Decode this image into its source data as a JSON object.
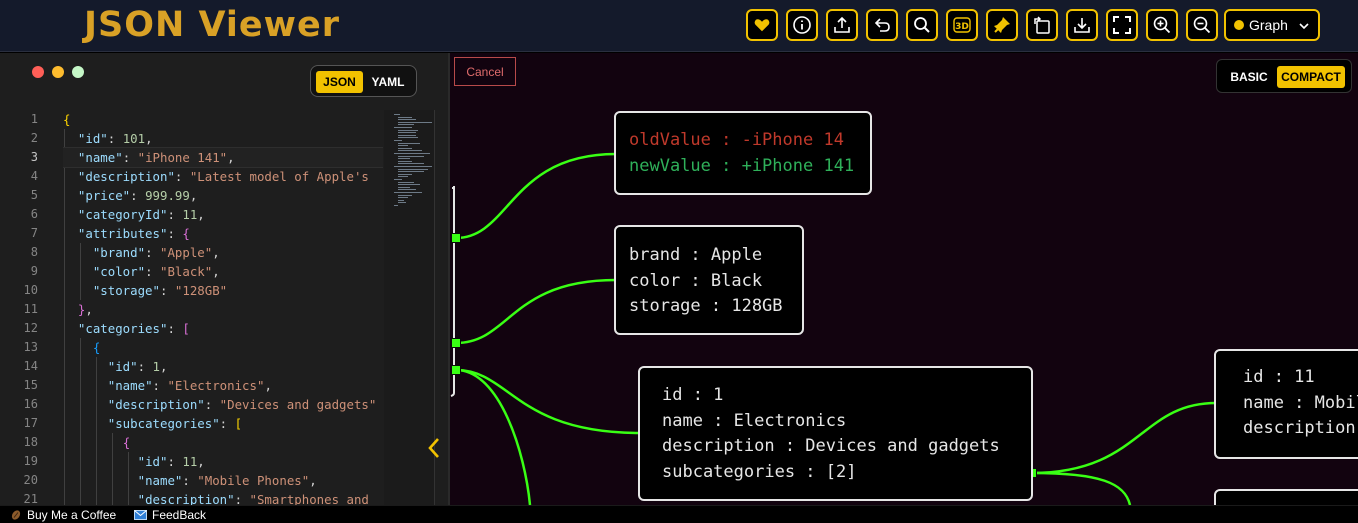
{
  "app": {
    "title": "JSON Viewer"
  },
  "toolbar": {
    "buttons": [
      "heart-icon",
      "info-icon",
      "upload-icon",
      "undo-icon",
      "search-icon",
      "3d-icon",
      "pin-icon",
      "rotate-icon",
      "download-icon",
      "fullscreen-icon",
      "zoom-in-icon",
      "zoom-out-icon"
    ],
    "view_select": "Graph"
  },
  "editor": {
    "format_json": "JSON",
    "format_yaml": "YAML",
    "line_numbers": [
      "1",
      "2",
      "3",
      "4",
      "5",
      "6",
      "7",
      "8",
      "9",
      "10",
      "11",
      "12",
      "13",
      "14",
      "15",
      "16",
      "17",
      "18",
      "19",
      "20",
      "21"
    ],
    "active_line": 3
  },
  "canvas": {
    "cancel_label": "Cancel",
    "mode_basic": "BASIC",
    "mode_compact": "COMPACT",
    "nodes": {
      "diff": [
        "oldValue : -iPhone 14",
        "newValue : +iPhone 141"
      ],
      "attributes": [
        "brand : Apple",
        "color : Black",
        "storage : 128GB"
      ],
      "category": [
        "id : 1",
        "name : Electronics",
        "description : Devices and gadgets",
        "subcategories : [2]"
      ],
      "subcategory": [
        "id : 11",
        "name : Mobile Phones",
        "description : Smartphones and"
      ]
    }
  },
  "footer": {
    "coffee": "Buy Me a Coffee",
    "feedback": "FeedBack"
  },
  "colors": {
    "accent": "#f2c200",
    "edge": "#39ff14",
    "logo": "#d9a126",
    "canvas_bg": "#12030f"
  }
}
